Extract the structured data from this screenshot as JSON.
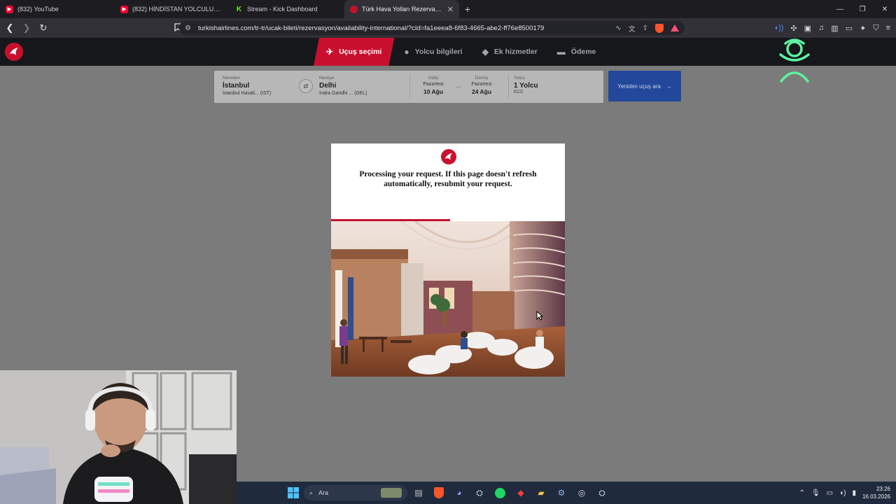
{
  "browser": {
    "tabs": [
      {
        "label": "(832) YouTube",
        "icon": "youtube-icon",
        "active": false
      },
      {
        "label": "(832) HİNDİSTAN YOLCULUĞU VE Hİ",
        "icon": "youtube-icon",
        "active": false
      },
      {
        "label": "Stream - Kick Dashboard",
        "icon": "kick-icon",
        "active": false
      },
      {
        "label": "Türk Hava Yolları Rezervasyon De",
        "icon": "turkish-airlines-icon",
        "active": true
      }
    ],
    "url": "turkishairlines.com/tr-tr/ucak-bileti/rezervasyon/availability-international/?cId=fa1eeea8-6f83-4665-abe2-ff76e8500179"
  },
  "airline": {
    "steps": [
      {
        "label": "Uçuş seçimi",
        "icon": "plane-icon",
        "active": true
      },
      {
        "label": "Yolcu bilgileri",
        "icon": "person-icon",
        "active": false
      },
      {
        "label": "Ek hizmetler",
        "icon": "extras-icon",
        "active": false
      },
      {
        "label": "Ödeme",
        "icon": "card-icon",
        "active": false
      }
    ],
    "search": {
      "from_label": "Nereden",
      "from_city": "İstanbul",
      "from_airport": "İstanbul Havali...",
      "from_code": "(IST)",
      "to_label": "Nereye",
      "to_city": "Delhi",
      "to_airport": "Indra Gandhi ...",
      "to_code": "(DEL)",
      "depart_label": "Gidiş",
      "depart_day": "Pazartesi",
      "depart_date": "10 Ağu",
      "dots": "...",
      "return_label": "Dönüş",
      "return_day": "Pazartesi",
      "return_date": "24 Ağu",
      "pax_label": "Yolcu",
      "pax_value": "1 Yolcu",
      "pax_class": "ECO",
      "search_again": "Yeniden uçuş ara"
    },
    "modal": {
      "message": "Processing your request. If this page doesn't refresh automatically, resubmit your request.",
      "progress": 0.51
    }
  },
  "taskbar": {
    "search_placeholder": "Ara",
    "time": "23:26",
    "date": "16.03.2026"
  },
  "colors": {
    "brand_red": "#c8102e",
    "search_button": "#23489b"
  }
}
